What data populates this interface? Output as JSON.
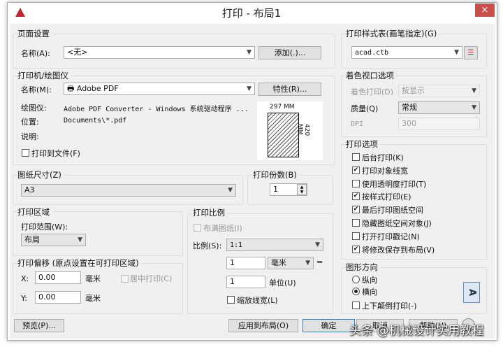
{
  "window": {
    "title": "打印 - 布局1",
    "close": "×"
  },
  "page_setup": {
    "label": "页面设置",
    "name_label": "名称(A):",
    "name_value": "<无>",
    "add_button": "添加(.)..."
  },
  "plotter": {
    "label": "打印机/绘图仪",
    "name_label": "名称(M):",
    "name_value": "Adobe PDF",
    "properties_button": "特性(R)...",
    "plotter_label": "绘图仪:",
    "plotter_value": "Adobe PDF Converter - Windows 系统驱动程序 ...",
    "location_label": "位置:",
    "location_value": "Documents\\*.pdf",
    "description_label": "说明:",
    "print_to_file": "打印到文件(F)",
    "paper_width": "297 MM",
    "paper_height": "420 MM"
  },
  "paper_size": {
    "label": "图纸尺寸(Z)",
    "value": "A3"
  },
  "copies": {
    "label": "打印份数(B)",
    "value": "1"
  },
  "plot_area": {
    "label": "打印区域",
    "range_label": "打印范围(W):",
    "range_value": "布局"
  },
  "plot_offset": {
    "label": "打印偏移 (原点设置在可打印区域)",
    "x_label": "X:",
    "x_value": "0.00",
    "y_label": "Y:",
    "y_value": "0.00",
    "unit": "毫米",
    "center": "居中打印(C)"
  },
  "plot_scale": {
    "label": "打印比例",
    "fit": "布满图纸(I)",
    "scale_label": "比例(S):",
    "scale_value": "1:1",
    "value1": "1",
    "unit1": "毫米",
    "equals": "=",
    "value2": "1",
    "unit2": "单位(U)",
    "scale_lineweights": "缩放线宽(L)"
  },
  "style_table": {
    "label": "打印样式表(画笔指定)(G)",
    "value": "acad.ctb"
  },
  "shaded": {
    "label": "着色视口选项",
    "shade_label": "着色打印(D)",
    "shade_value": "按显示",
    "quality_label": "质量(Q)",
    "quality_value": "常规",
    "dpi_label": "DPI",
    "dpi_value": "300"
  },
  "options": {
    "label": "打印选项",
    "items": [
      {
        "label": "后台打印(K)",
        "checked": false
      },
      {
        "label": "打印对象线宽",
        "checked": true
      },
      {
        "label": "使用透明度打印(T)",
        "checked": false
      },
      {
        "label": "按样式打印(E)",
        "checked": true
      },
      {
        "label": "最后打印图纸空间",
        "checked": true
      },
      {
        "label": "隐藏图纸空间对象(J)",
        "checked": false
      },
      {
        "label": "打开打印戳记(N)",
        "checked": false
      },
      {
        "label": "将修改保存到布局(V)",
        "checked": true
      }
    ]
  },
  "orientation": {
    "label": "图形方向",
    "portrait": "纵向",
    "landscape": "横向",
    "upside_down": "上下颠倒打印(-)",
    "icon_letter": "A"
  },
  "buttons": {
    "preview": "预览(P)...",
    "apply": "应用到布局(O)",
    "ok": "确定",
    "cancel": "取消",
    "help": "帮助(H)"
  },
  "watermark": "头条 @机械设计实用教程"
}
